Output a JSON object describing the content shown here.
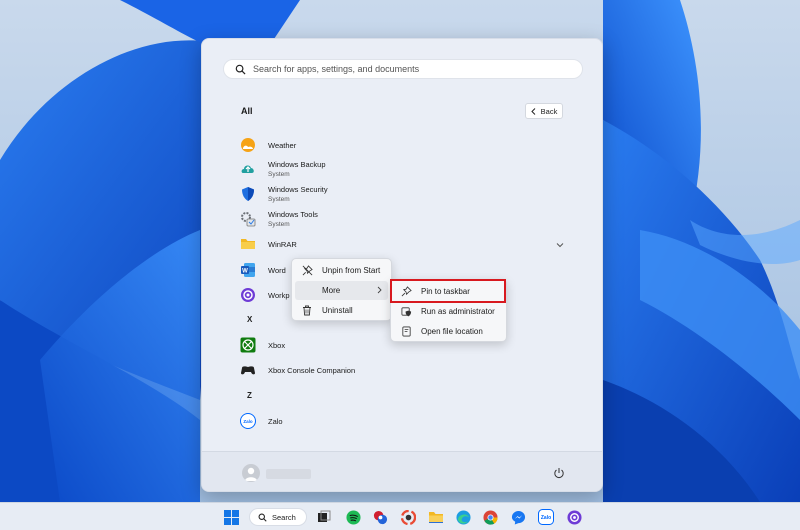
{
  "start_menu": {
    "search_placeholder": "Search for apps, settings, and documents",
    "section_title": "All",
    "back_label": "Back",
    "apps": [
      {
        "name": "Weather",
        "sub": ""
      },
      {
        "name": "Windows Backup",
        "sub": "System"
      },
      {
        "name": "Windows Security",
        "sub": "System"
      },
      {
        "name": "Windows Tools",
        "sub": "System"
      },
      {
        "name": "WinRAR",
        "sub": ""
      },
      {
        "name": "Word",
        "sub": ""
      },
      {
        "name": "Workp",
        "sub": ""
      },
      {
        "name": "Xbox",
        "sub": ""
      },
      {
        "name": "Xbox Console Companion",
        "sub": ""
      },
      {
        "name": "Zalo",
        "sub": ""
      }
    ],
    "letters": [
      "X",
      "Z"
    ],
    "zalo_icon_text": "Zalo"
  },
  "context_menu": {
    "items": [
      {
        "label": "Unpin from Start",
        "icon": "unpin-icon"
      },
      {
        "label": "More",
        "icon": ""
      },
      {
        "label": "Uninstall",
        "icon": "trash-icon"
      }
    ]
  },
  "submenu": {
    "items": [
      {
        "label": "Pin to taskbar",
        "icon": "pin-icon"
      },
      {
        "label": "Run as administrator",
        "icon": "shield-admin-icon"
      },
      {
        "label": "Open file location",
        "icon": "folder-open-icon"
      }
    ]
  },
  "taskbar": {
    "search_label": "Search",
    "zalo_label": "Zalo"
  },
  "colors": {
    "highlight": "#d8191f",
    "accent": "#0b5cd6"
  }
}
